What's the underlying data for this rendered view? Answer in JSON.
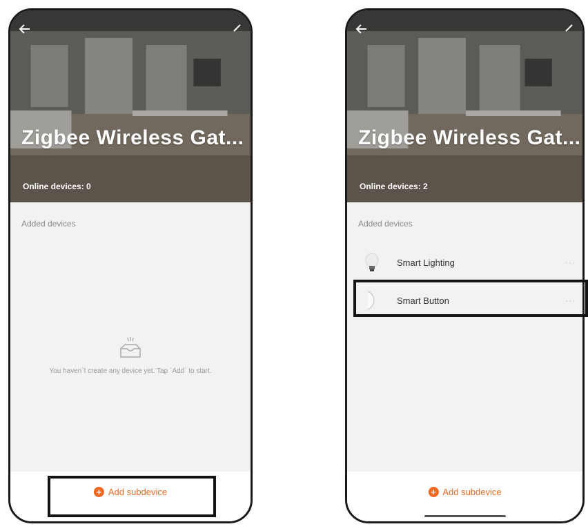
{
  "left_screen": {
    "title": "Zigbee Wireless Gat...",
    "online_devices": "Online devices: 0",
    "section_label": "Added devices",
    "empty_message": "You haven`t create any device yet. Tap `Add` to start.",
    "add_button_label": "Add subdevice"
  },
  "right_screen": {
    "title": "Zigbee Wireless Gat...",
    "online_devices": "Online devices: 2",
    "section_label": "Added devices",
    "devices": [
      {
        "name": "Smart Lighting",
        "icon": "bulb-icon",
        "more": "···"
      },
      {
        "name": "Smart Button",
        "icon": "smart-button-icon",
        "more": "···"
      }
    ],
    "add_button_label": "Add subdevice"
  },
  "colors": {
    "accent": "#ee6a23",
    "background": "#f2f2f2",
    "highlight_border": "#141414"
  }
}
